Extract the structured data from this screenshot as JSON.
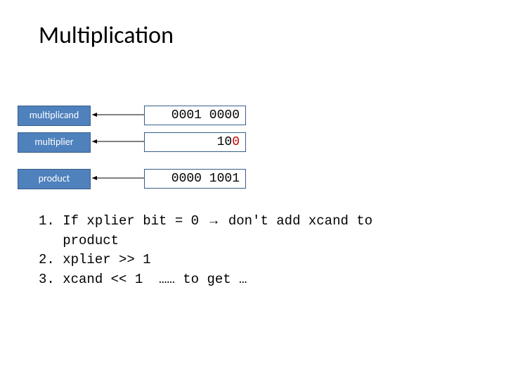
{
  "title": "Multiplication",
  "labels": {
    "multiplicand": "multiplicand",
    "multiplier": "multiplier",
    "product": "product"
  },
  "values": {
    "multiplicand": "0001 0000",
    "multiplier_prefix": "10",
    "multiplier_bit": "0",
    "product": "0000 1001"
  },
  "steps": {
    "line1a": "1. If xplier bit = 0 ",
    "line1arrow": "→",
    "line1b": " don't add xcand to",
    "line1c": "   product",
    "line2": "2. xplier >> 1",
    "line3": "3. xcand << 1  …… to get …"
  }
}
